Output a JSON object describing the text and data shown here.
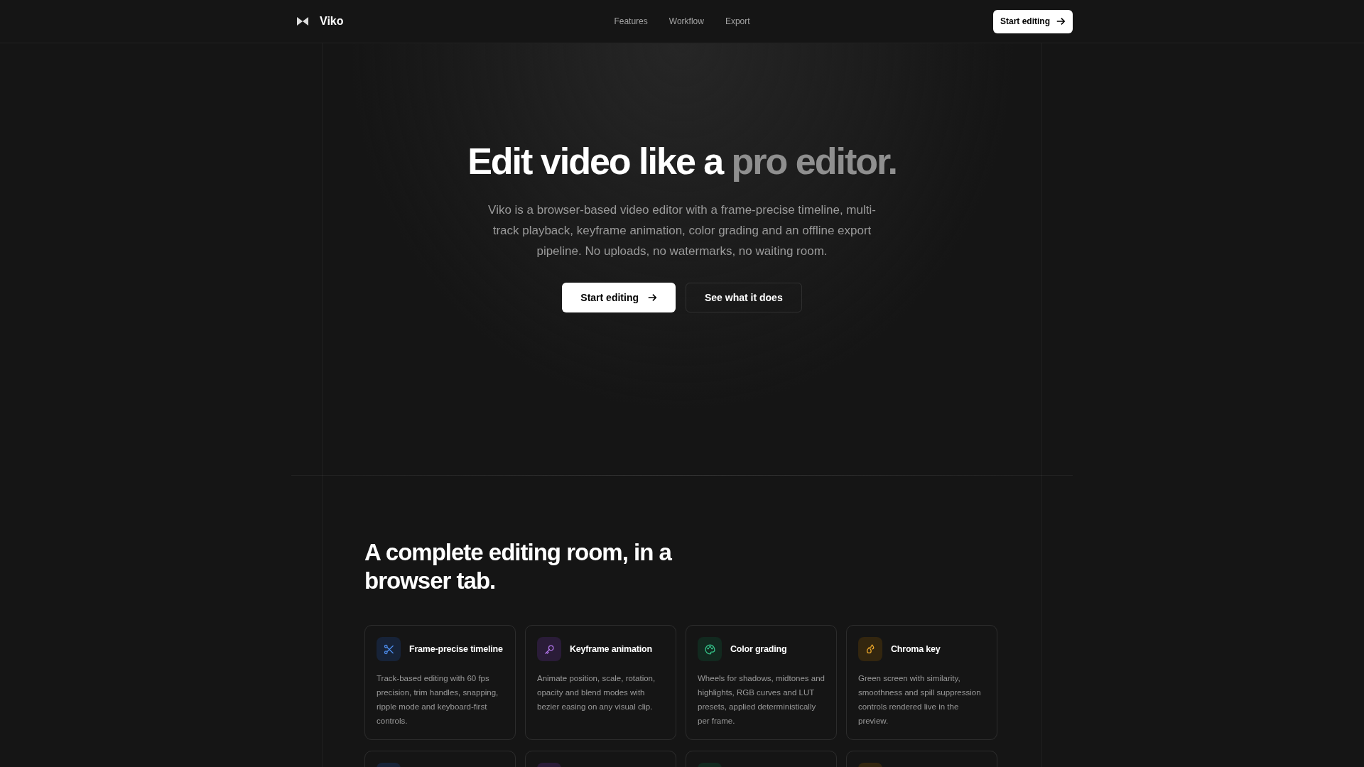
{
  "nav": {
    "brand": "Viko",
    "links": [
      "Features",
      "Workflow",
      "Export"
    ],
    "cta": "Start editing"
  },
  "hero": {
    "title_main": "Edit video like a",
    "title_accent": "pro editor.",
    "text": "Viko is a browser-based video editor with a frame-precise timeline, multi-track playback, keyframe animation, color grading and an offline export pipeline. No uploads, no watermarks, no waiting room.",
    "primary": "Start editing",
    "secondary": "See what it does"
  },
  "features": {
    "title": "A complete editing room, in a browser tab.",
    "cards": [
      {
        "title": "Frame-precise timeline",
        "text": "Track-based editing with 60 fps precision, trim handles, snapping, ripple mode and keyboard-first controls."
      },
      {
        "title": "Keyframe animation",
        "text": "Animate position, scale, rotation, opacity and blend modes with bezier easing on any visual clip."
      },
      {
        "title": "Color grading",
        "text": "Wheels for shadows, midtones and highlights, RGB curves and LUT presets, applied deterministically per frame."
      },
      {
        "title": "Chroma key",
        "text": "Green screen with similarity, smoothness and spill suppression controls rendered live in the preview."
      }
    ]
  }
}
